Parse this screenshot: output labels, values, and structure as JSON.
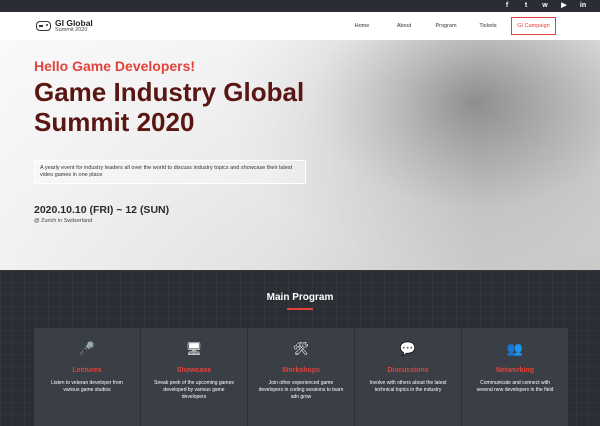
{
  "social": [
    {
      "name": "facebook-icon",
      "glyph": "f"
    },
    {
      "name": "twitter-icon",
      "glyph": "t"
    },
    {
      "name": "twitch-icon",
      "glyph": "w"
    },
    {
      "name": "youtube-icon",
      "glyph": "▶"
    },
    {
      "name": "linkedin-icon",
      "glyph": "in"
    }
  ],
  "brand": {
    "title": "GI Global",
    "subtitle": "Summit 2020"
  },
  "menu": {
    "items": [
      "Home",
      "About",
      "Program",
      "Tickets"
    ],
    "cta": "GI Campaign"
  },
  "hero": {
    "hello": "Hello Game Developers!",
    "title_line1": "Game Industry Global",
    "title_line2": "Summit 2020",
    "description": "A yearly event for industry leaders all over the world to discuss industry topics and showcase their latest video games in one place",
    "date": "2020.10.10 (FRI) ~ 12 (SUN)",
    "location": "@ Zurich in Switzerland"
  },
  "program": {
    "title": "Main Program",
    "cards": [
      {
        "icon": "microphone-icon",
        "glyph": "🎤",
        "title": "Lectures",
        "text": "Listen to veteran developer from various game studios"
      },
      {
        "icon": "monitor-icon",
        "glyph": "🖥",
        "title": "Showcase",
        "text": "Sneak peek of the upcoming games developed by various game developers"
      },
      {
        "icon": "tools-icon",
        "glyph": "🛠",
        "title": "Workshops",
        "text": "Join other experienced game developers in coding sessions to learn adn grow"
      },
      {
        "icon": "chat-icon",
        "glyph": "💬",
        "title": "Discussions",
        "text": "Involve with others about the latest technical topics in the industry"
      },
      {
        "icon": "people-icon",
        "glyph": "👥",
        "title": "Networking",
        "text": "Communicate and connect with several new developers in the field"
      }
    ]
  },
  "colors": {
    "accent": "#e0443c",
    "dark": "#2b2e34",
    "title": "#5a1612"
  }
}
